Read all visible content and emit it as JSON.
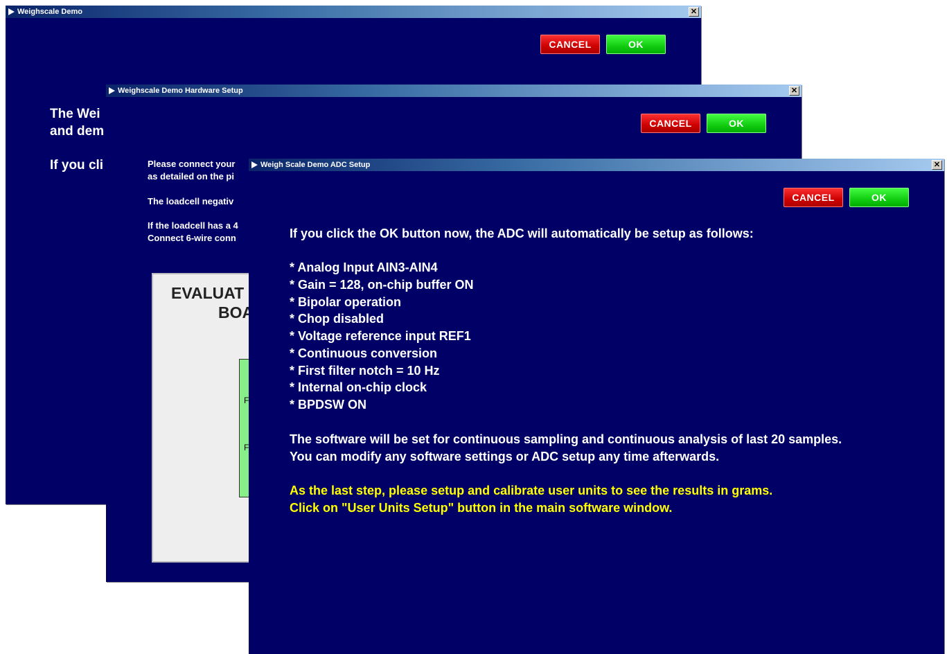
{
  "colors": {
    "dialog_bg": "#000066",
    "text": "#ffffff",
    "highlight": "#ffff00",
    "cancel": "#e00000",
    "ok": "#22dd22"
  },
  "win1": {
    "title": "Weighscale Demo",
    "close": "✕",
    "cancel_label": "CANCEL",
    "ok_label": "OK",
    "line1": "The Wei",
    "line2": "and dem",
    "line3": "If you cli"
  },
  "win2": {
    "title": "Weighscale Demo Hardware Setup",
    "close": "✕",
    "cancel_label": "CANCEL",
    "ok_label": "OK",
    "p1a": "Please connect your",
    "p1b": "as detailed on the pi",
    "p2": "The loadcell negativ",
    "p3a": "If the loadcell has a 4",
    "p3b": "Connect 6-wire conn",
    "board_line1": "EVALUAT",
    "board_line2": "BOA",
    "board_label1": "F",
    "board_label2": "F"
  },
  "win3": {
    "title": "Weigh Scale Demo ADC Setup",
    "close": "✕",
    "cancel_label": "CANCEL",
    "ok_label": "OK",
    "intro": "If you click the OK button now, the ADC will automatically be setup as follows:",
    "settings": [
      "* Analog Input AIN3-AIN4",
      "* Gain = 128, on-chip buffer ON",
      "* Bipolar operation",
      "* Chop disabled",
      "* Voltage reference input REF1",
      "* Continuous conversion",
      "* First filter notch = 10 Hz",
      "* Internal on-chip clock",
      "* BPDSW ON"
    ],
    "software_line1": "The software will be set for continuous sampling and continuous analysis of last 20 samples.",
    "software_line2": "You can modify any software settings or ADC setup any time afterwards.",
    "last_line1": "As the last step, please setup and calibrate user units to see the results in grams.",
    "last_line2": "Click on \"User Units Setup\" button in the main software window."
  }
}
